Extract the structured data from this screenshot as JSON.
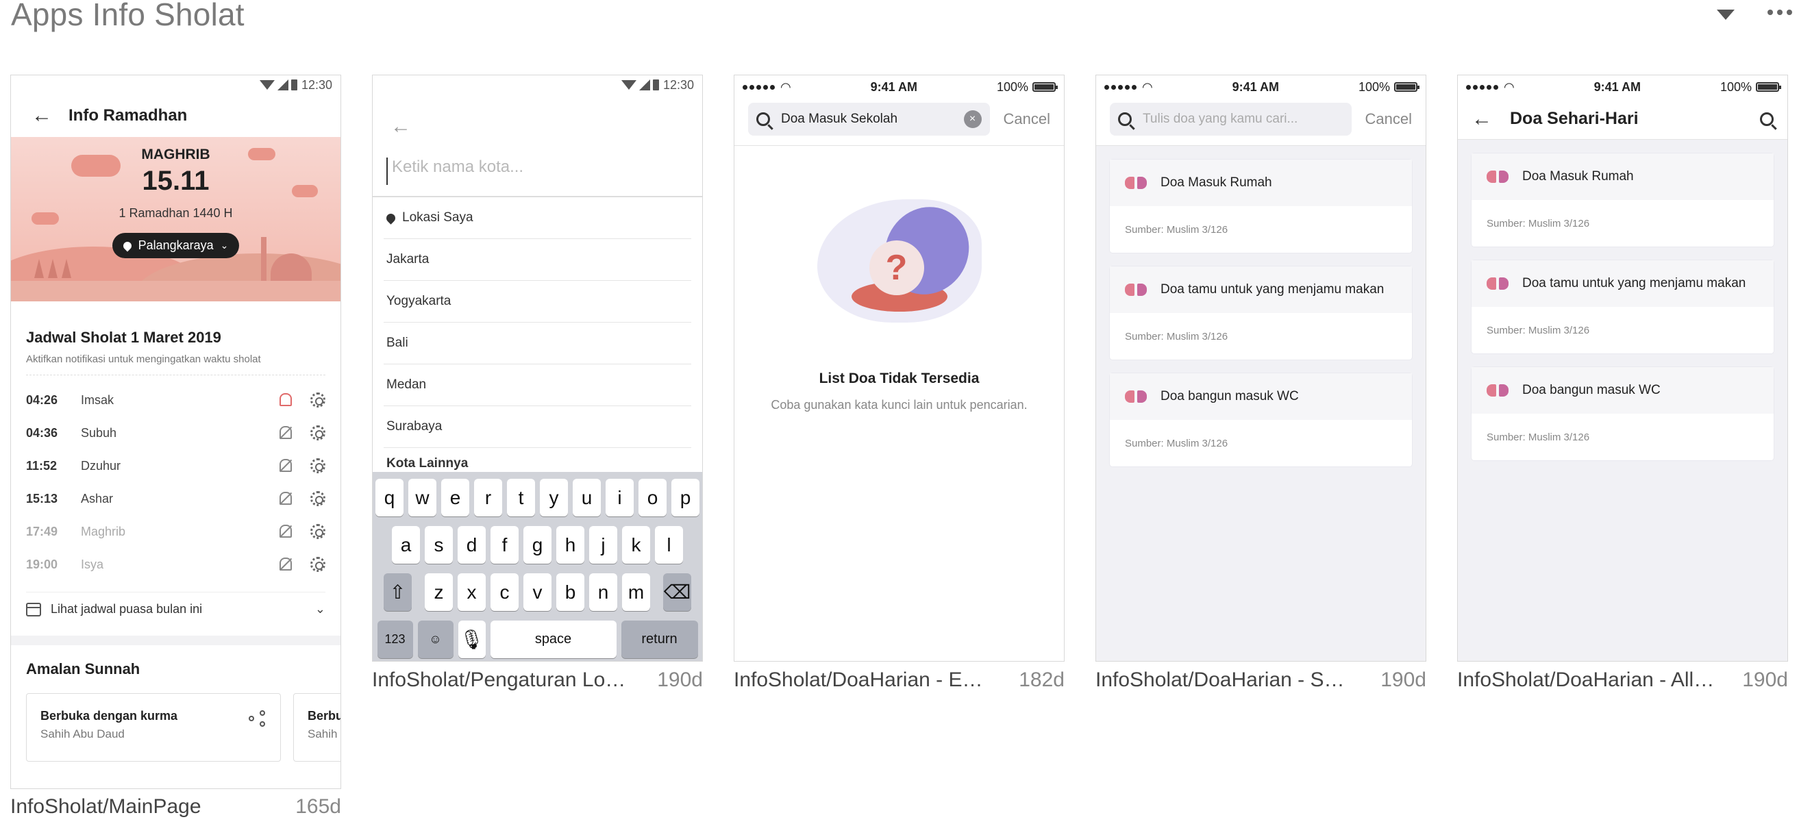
{
  "page": {
    "title": "Apps Info Sholat"
  },
  "icons": {
    "dropdown": "triangle-down-icon",
    "more": "more-horizontal-icon"
  },
  "colors": {
    "hero_bg": "#f2b8ad",
    "accent_pink": "#e07a8e",
    "kbd_bg": "#d1d3d9"
  },
  "frames": [
    {
      "name": "InfoSholat/MainPage",
      "age": "165d"
    },
    {
      "name": "InfoSholat/Pengaturan Lokasi",
      "age": "190d"
    },
    {
      "name": "InfoSholat/DoaHarian - Empty",
      "age": "182d"
    },
    {
      "name": "InfoSholat/DoaHarian - Sear…",
      "age": "190d"
    },
    {
      "name": "InfoSholat/DoaHarian - All Li…",
      "age": "190d"
    }
  ],
  "main": {
    "status_time": "12:30",
    "title": "Info Ramadhan",
    "hero": {
      "label": "MAGHRIB",
      "time": "15.11",
      "date": "1 Ramadhan 1440 H",
      "city": "Palangkaraya"
    },
    "schedule": {
      "title": "Jadwal Sholat 1 Maret 2019",
      "subtitle": "Aktifkan notifikasi untuk mengingatkan waktu sholat",
      "rows": [
        {
          "time": "04:26",
          "name": "Imsak"
        },
        {
          "time": "04:36",
          "name": "Subuh"
        },
        {
          "time": "11:52",
          "name": "Dzuhur"
        },
        {
          "time": "15:13",
          "name": "Ashar"
        },
        {
          "time": "17:49",
          "name": "Maghrib"
        },
        {
          "time": "19:00",
          "name": "Isya"
        }
      ]
    },
    "fasting_link": "Lihat jadwal puasa bulan ini",
    "amalan": {
      "title": "Amalan Sunnah",
      "cards": [
        {
          "title": "Berbuka dengan kurma",
          "source": "Sahih Abu Daud"
        },
        {
          "title": "Berbu",
          "source": "Sahih"
        }
      ]
    }
  },
  "location": {
    "status_time": "12:30",
    "placeholder": "Ketik nama kota...",
    "items": [
      "Lokasi Saya",
      "Jakarta",
      "Yogyakarta",
      "Bali",
      "Medan",
      "Surabaya"
    ],
    "partial_section": "Kota Lainnya",
    "keyboard": {
      "row1": [
        "q",
        "w",
        "e",
        "r",
        "t",
        "y",
        "u",
        "i",
        "o",
        "p"
      ],
      "row2": [
        "a",
        "s",
        "d",
        "f",
        "g",
        "h",
        "j",
        "k",
        "l"
      ],
      "row3": [
        "z",
        "x",
        "c",
        "v",
        "b",
        "n",
        "m"
      ],
      "num": "123",
      "space": "space",
      "return": "return"
    }
  },
  "empty": {
    "status_time": "9:41 AM",
    "battery": "100%",
    "query": "Doa Masuk Sekolah",
    "cancel": "Cancel",
    "title": "List Doa Tidak Tersedia",
    "subtitle": "Coba gunakan kata kunci lain untuk pencarian."
  },
  "search": {
    "status_time": "9:41 AM",
    "battery": "100%",
    "placeholder": "Tulis doa yang kamu cari...",
    "cancel": "Cancel",
    "items": [
      {
        "title": "Doa Masuk Rumah",
        "source": "Sumber: Muslim 3/126"
      },
      {
        "title": "Doa tamu untuk yang menjamu makan",
        "source": "Sumber: Muslim 3/126"
      },
      {
        "title": "Doa bangun masuk WC",
        "source": "Sumber: Muslim 3/126"
      }
    ]
  },
  "all_list": {
    "status_time": "9:41 AM",
    "battery": "100%",
    "title": "Doa Sehari-Hari",
    "items": [
      {
        "title": "Doa Masuk Rumah",
        "source": "Sumber: Muslim 3/126"
      },
      {
        "title": "Doa tamu untuk yang menjamu makan",
        "source": "Sumber: Muslim 3/126"
      },
      {
        "title": "Doa bangun masuk WC",
        "source": "Sumber: Muslim 3/126"
      }
    ]
  }
}
